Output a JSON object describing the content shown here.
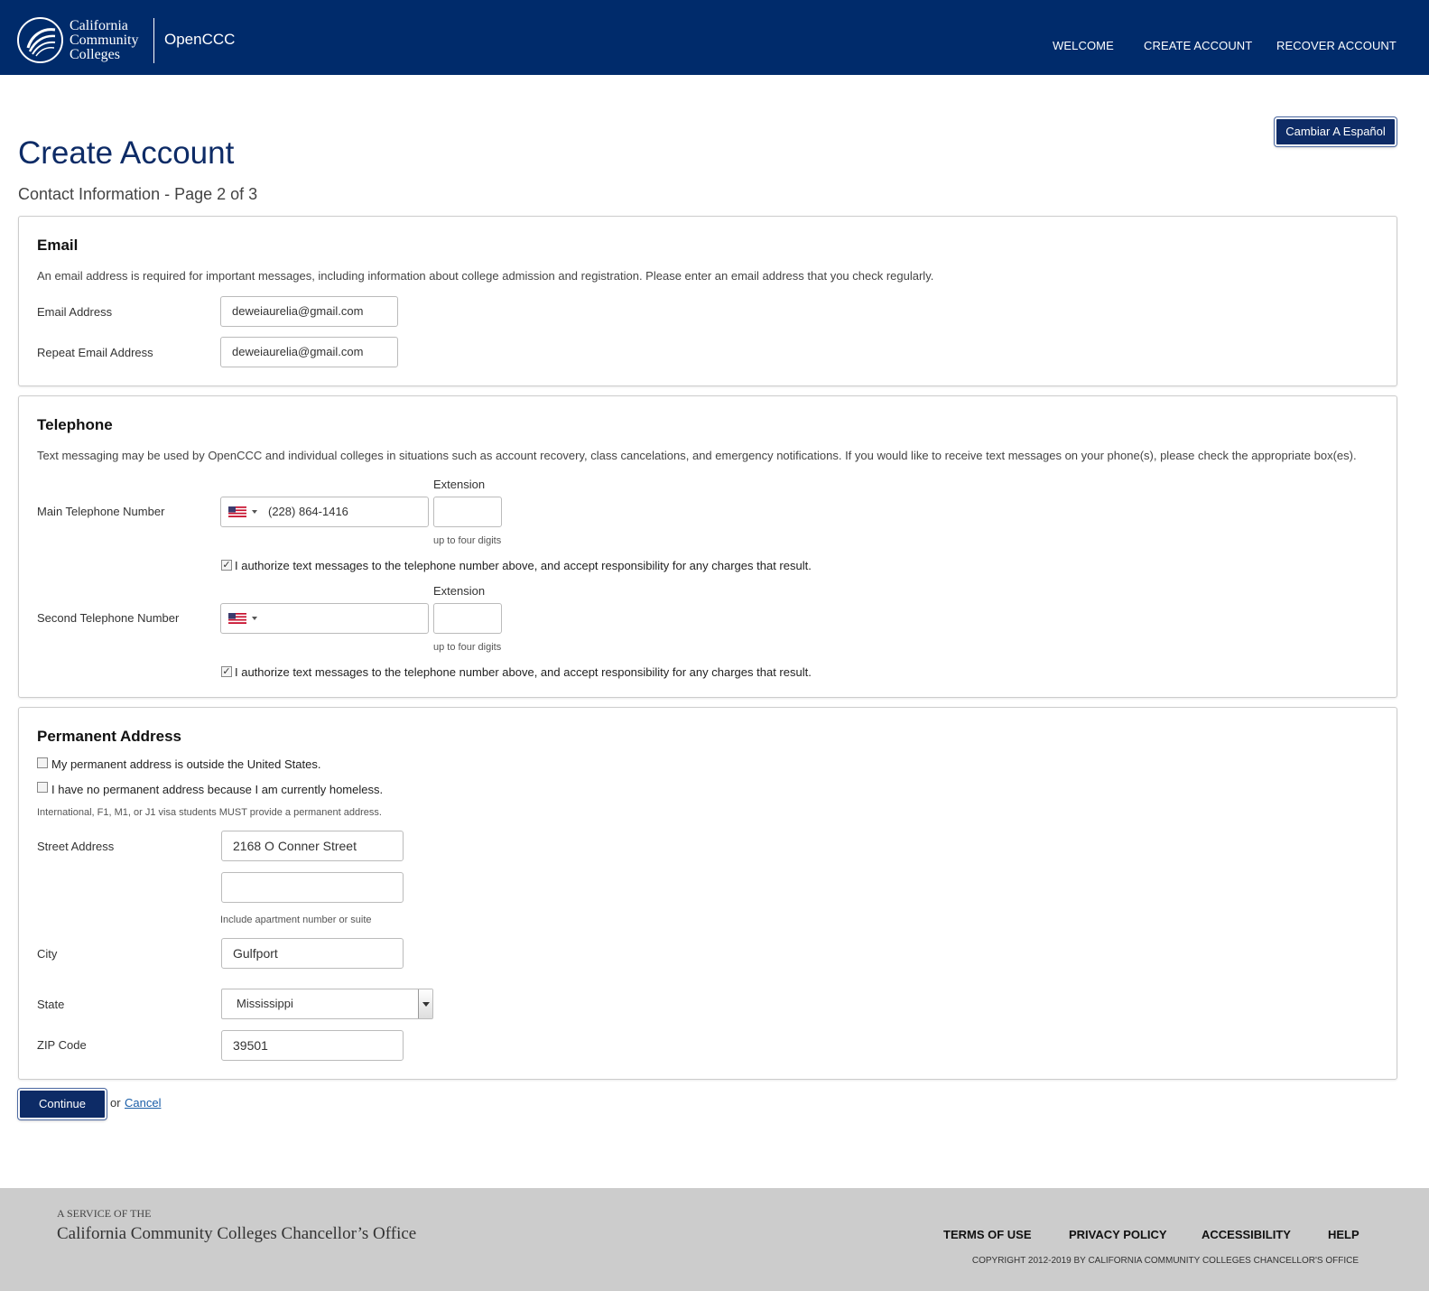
{
  "header": {
    "logo_lines": [
      "California",
      "Community",
      "Colleges"
    ],
    "brand": "OpenCCC",
    "nav": [
      "WELCOME",
      "CREATE ACCOUNT",
      "RECOVER ACCOUNT"
    ],
    "bg_color": "#002b6b"
  },
  "lang_button": "Cambiar A Español",
  "title": "Create Account",
  "subtitle": "Contact Information - Page 2 of 3",
  "email": {
    "heading": "Email",
    "description": "An email address is required for important messages, including information about college admission and registration. Please enter an email address that you check regularly.",
    "email_label": "Email Address",
    "email_value": "deweiaurelia@gmail.com",
    "repeat_label": "Repeat Email Address",
    "repeat_value": "deweiaurelia@gmail.com"
  },
  "telephone": {
    "heading": "Telephone",
    "description": "Text messaging may be used by OpenCCC and individual colleges in situations such as account recovery, class cancelations, and emergency notifications. If you would like to receive text messages on your phone(s), please check the appropriate box(es).",
    "main_label": "Main Telephone Number",
    "main_value": "(228) 864-1416",
    "second_label": "Second Telephone Number",
    "second_value": "",
    "extension_label": "Extension",
    "extension_hint": "up to four digits",
    "authorize_text": "I authorize text messages to the telephone number above, and accept responsibility for any charges that result.",
    "authorize_main_checked": true,
    "authorize_second_checked": true,
    "country_icon": "us-flag-icon"
  },
  "address": {
    "heading": "Permanent Address",
    "outside_us": "My permanent address is outside the United States.",
    "homeless": "I have no permanent address because I am currently homeless.",
    "visa_note": "International, F1, M1, or J1 visa students MUST provide a permanent address.",
    "street_label": "Street Address",
    "street_value": "2168  O Conner Street",
    "street2_value": "",
    "street_hint": "Include apartment number or suite",
    "city_label": "City",
    "city_value": "Gulfport",
    "state_label": "State",
    "state_value": "Mississippi",
    "zip_label": "ZIP Code",
    "zip_value": "39501"
  },
  "actions": {
    "continue": "Continue",
    "or": "or",
    "cancel": "Cancel"
  },
  "footer": {
    "service_of": "A SERVICE OF THE",
    "org": "California Community Colleges Chancellor’s Office",
    "links": [
      "TERMS OF USE",
      "PRIVACY POLICY",
      "ACCESSIBILITY",
      "HELP"
    ],
    "copyright": "COPYRIGHT 2012-2019 BY CALIFORNIA COMMUNITY COLLEGES CHANCELLOR'S OFFICE"
  }
}
